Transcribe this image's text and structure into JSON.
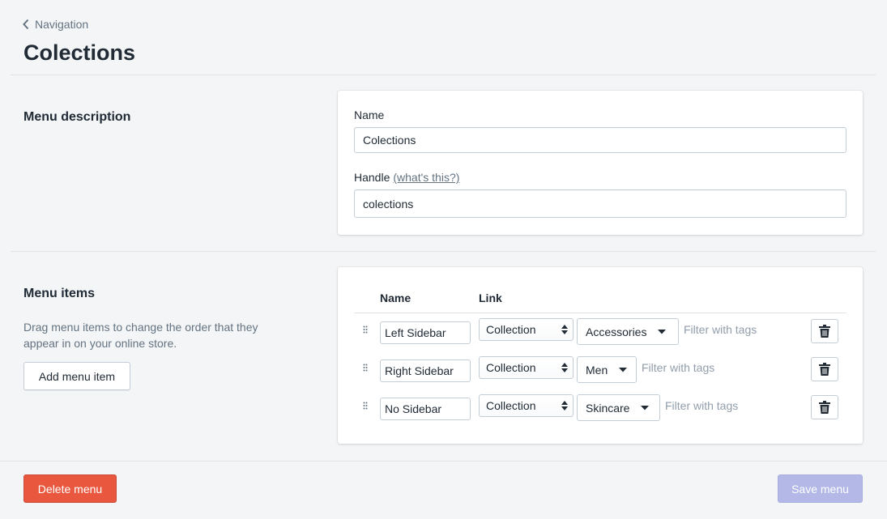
{
  "breadcrumb": {
    "label": "Navigation"
  },
  "page": {
    "title": "Colections"
  },
  "menu_description": {
    "heading": "Menu description",
    "name_label": "Name",
    "name_value": "Colections",
    "handle_label": "Handle",
    "handle_help": "(what's this?)",
    "handle_value": "colections"
  },
  "menu_items": {
    "heading": "Menu items",
    "description": "Drag menu items to change the order that they appear in on your online store.",
    "add_button": "Add menu item",
    "columns": {
      "name": "Name",
      "link": "Link"
    },
    "rows": [
      {
        "name": "Left Sidebar",
        "link_type": "Collection",
        "target": "Accessories",
        "filter": "Filter with tags"
      },
      {
        "name": "Right Sidebar",
        "link_type": "Collection",
        "target": "Men",
        "filter": "Filter with tags"
      },
      {
        "name": "No Sidebar",
        "link_type": "Collection",
        "target": "Skincare",
        "filter": "Filter with tags"
      }
    ]
  },
  "footer": {
    "delete_label": "Delete menu",
    "save_label": "Save menu"
  },
  "colors": {
    "danger": "#e9573f",
    "primary_disabled": "#b3b8e6",
    "background": "#f4f5f7"
  }
}
